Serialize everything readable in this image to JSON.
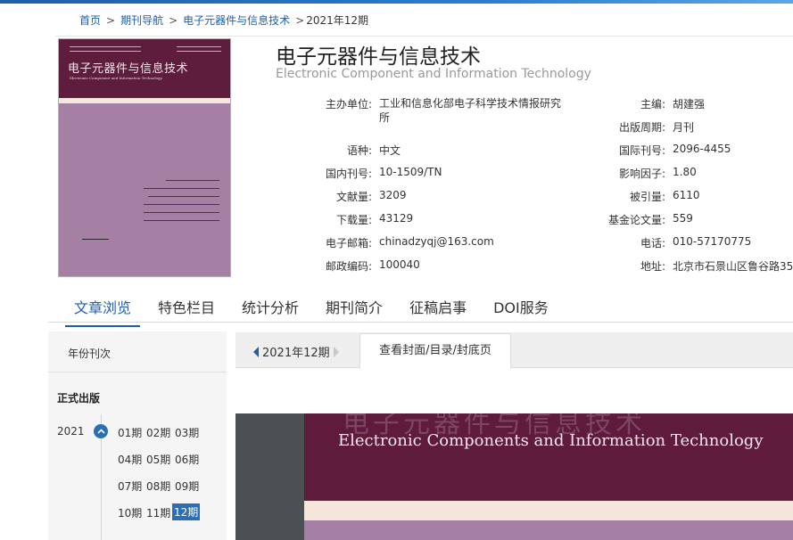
{
  "breadcrumb": {
    "home": "首页",
    "journal_nav": "期刊导航",
    "journal": "电子元器件与信息技术",
    "current": "2021年12期"
  },
  "journal": {
    "title_cn": "电子元器件与信息技术",
    "title_en": "Electronic Component and Information Technology"
  },
  "cover_thumb": {
    "cn_title": "电子元器件与信息技术",
    "en_title": "Electronic Component and Information Technology"
  },
  "info_left": [
    {
      "label": "主办单位:",
      "value": "工业和信息化部电子科学技术情报研究所"
    },
    {
      "label": "语种:",
      "value": "中文"
    },
    {
      "label": "国内刊号:",
      "value": "10-1509/TN"
    },
    {
      "label": "文献量:",
      "value": "3209"
    },
    {
      "label": "下载量:",
      "value": "43129"
    },
    {
      "label": "电子邮箱:",
      "value": "chinadzyqj@163.com"
    },
    {
      "label": "邮政编码:",
      "value": "100040"
    }
  ],
  "info_right": [
    {
      "label": "主编:",
      "value": "胡建强"
    },
    {
      "label": "出版周期:",
      "value": "月刊"
    },
    {
      "label": "国际刊号:",
      "value": "2096-4455"
    },
    {
      "label": "影响因子:",
      "value": "1.80"
    },
    {
      "label": "被引量:",
      "value": "6110"
    },
    {
      "label": "基金论文量:",
      "value": "559"
    },
    {
      "label": "电话:",
      "value": "010-57170775"
    },
    {
      "label": "地址:",
      "value": "北京市石景山区鲁谷路35"
    }
  ],
  "tabs": [
    "文章浏览",
    "特色栏目",
    "统计分析",
    "期刊简介",
    "征稿启事",
    "DOI服务"
  ],
  "sidebar": {
    "header": "年份刊次",
    "section": "正式出版",
    "year": "2021",
    "issues": [
      "01期",
      "02期",
      "03期",
      "04期",
      "05期",
      "06期",
      "07期",
      "08期",
      "09期",
      "10期",
      "11期",
      "12期"
    ],
    "selected_issue": "12期"
  },
  "issue_bar": {
    "current": "2021年12期",
    "view_tab": "查看封面/目录/封底页"
  },
  "big_cover": {
    "en_title": "Electronic Components and Information Technology"
  },
  "colors": {
    "accent": "#1f5ea8",
    "cover_maroon": "#5e1b3b",
    "cover_lilac": "#a67fa5"
  }
}
